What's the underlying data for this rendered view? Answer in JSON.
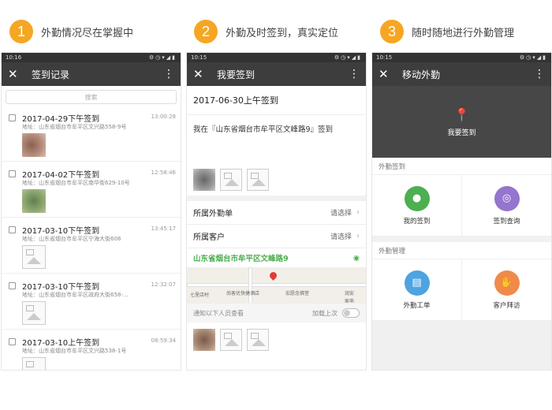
{
  "captions": [
    {
      "num": "1",
      "text": "外勤情况尽在掌握中"
    },
    {
      "num": "2",
      "text": "外勤及时签到，真实定位"
    },
    {
      "num": "3",
      "text": "随时随地进行外勤管理"
    }
  ],
  "colors": {
    "accent": "#f5a623",
    "titlebar": "#3d3d3d",
    "green": "#4caf50",
    "purple": "#9575cd",
    "blue": "#4fa3e0",
    "orange": "#f08a4b"
  },
  "phone1": {
    "time": "10:16",
    "title": "签到记录",
    "search_placeholder": "搜索",
    "records": [
      {
        "date": "2017-04-29下午签到",
        "time": "13:00:28",
        "address": "地址：山东省烟台市牟平区文兴路558-9号"
      },
      {
        "date": "2017-04-02下午签到",
        "time": "12:58:46",
        "address": "地址：山东省烟台市牟平区南华街629-10号"
      },
      {
        "date": "2017-03-10下午签到",
        "time": "13:45:17",
        "address": "地址：山东省烟台市牟平区宁海大街608"
      },
      {
        "date": "2017-03-10下午签到",
        "time": "12:32:07",
        "address": "地址：山东省烟台市牟平区政府大街658-…"
      },
      {
        "date": "2017-03-10上午签到",
        "time": "08:59:34",
        "address": "地址：山东省烟台市牟平区文兴路538-1号"
      }
    ]
  },
  "phone2": {
    "time": "10:15",
    "title": "我要签到",
    "date": "2017-06-30上午签到",
    "note": "我在『山东省烟台市牟平区文峰路9』签到",
    "rows": [
      {
        "label": "所属外勤单",
        "value": "请选择"
      },
      {
        "label": "所属客户",
        "value": "请选择"
      }
    ],
    "location": "山东省烟台市牟平区文峰路9",
    "map_labels": [
      "七里店村",
      "尚客优快捷酒店",
      "宏愿念佛堂",
      "润安",
      "家电"
    ],
    "notify": "通知以下人员查看",
    "load_last": "加载上次"
  },
  "phone3": {
    "time": "10:15",
    "title": "移动外勤",
    "hero_label": "我要签到",
    "section1": "外勤签到",
    "section2": "外勤管理",
    "items": [
      {
        "label": "我的签到",
        "icon": "person-icon"
      },
      {
        "label": "签到查询",
        "icon": "location-search-icon"
      },
      {
        "label": "外勤工单",
        "icon": "document-icon"
      },
      {
        "label": "客户拜访",
        "icon": "handshake-icon"
      }
    ]
  }
}
